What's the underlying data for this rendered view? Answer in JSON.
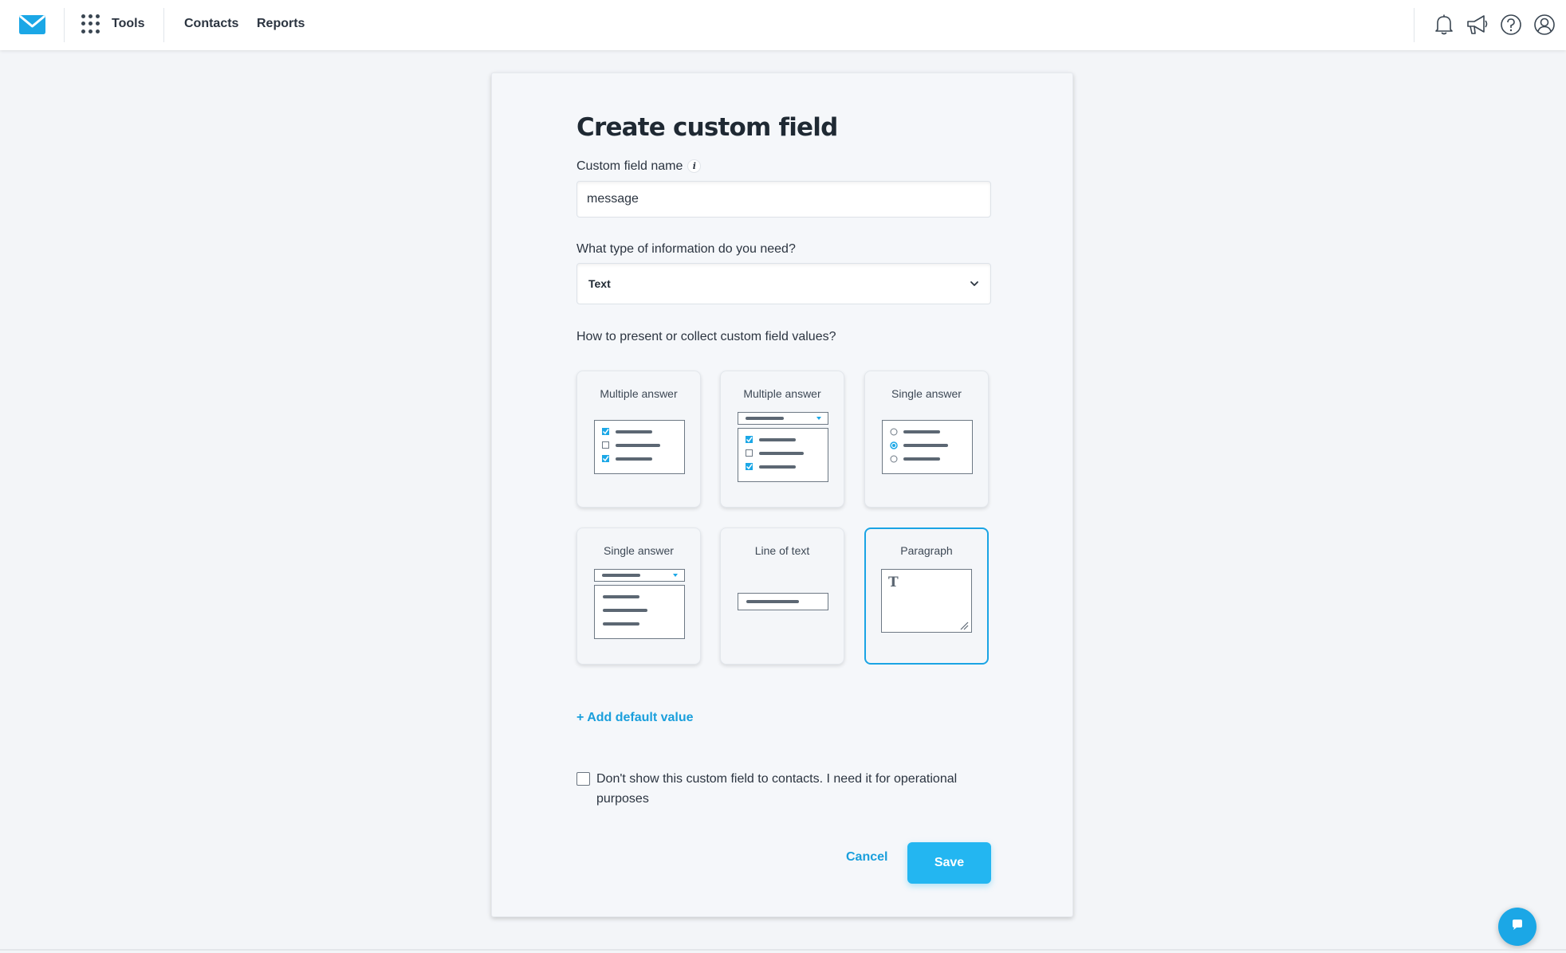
{
  "topbar": {
    "logo_icon": "envelope-logo",
    "apps_icon": "grid-icon",
    "tools_label": "Tools",
    "nav": [
      {
        "label": "Contacts"
      },
      {
        "label": "Reports"
      }
    ],
    "icons": [
      "bell-icon",
      "megaphone-icon",
      "help-icon",
      "user-icon"
    ]
  },
  "form": {
    "title": "Create custom field",
    "name_label": "Custom field name",
    "name_value": "message",
    "type_label": "What type of information do you need?",
    "type_value": "Text",
    "present_label": "How to present or collect custom field values?",
    "options": [
      {
        "label": "Multiple answer",
        "kind": "checkbox-list",
        "selected": false
      },
      {
        "label": "Multiple answer",
        "kind": "dropdown-checkbox-list",
        "selected": false
      },
      {
        "label": "Single answer",
        "kind": "radio-list",
        "selected": false
      },
      {
        "label": "Single answer",
        "kind": "dropdown-list",
        "selected": false
      },
      {
        "label": "Line of text",
        "kind": "single-line",
        "selected": false
      },
      {
        "label": "Paragraph",
        "kind": "textarea",
        "selected": true
      }
    ],
    "add_default": "+ Add default value",
    "hide_checkbox_label": "Don't show this custom field to contacts. I need it for operational purposes",
    "hide_checked": false,
    "cancel_label": "Cancel",
    "save_label": "Save"
  },
  "colors": {
    "accent": "#1aa4e4",
    "save_button": "#23b6f1",
    "background": "#f3f5f8"
  }
}
